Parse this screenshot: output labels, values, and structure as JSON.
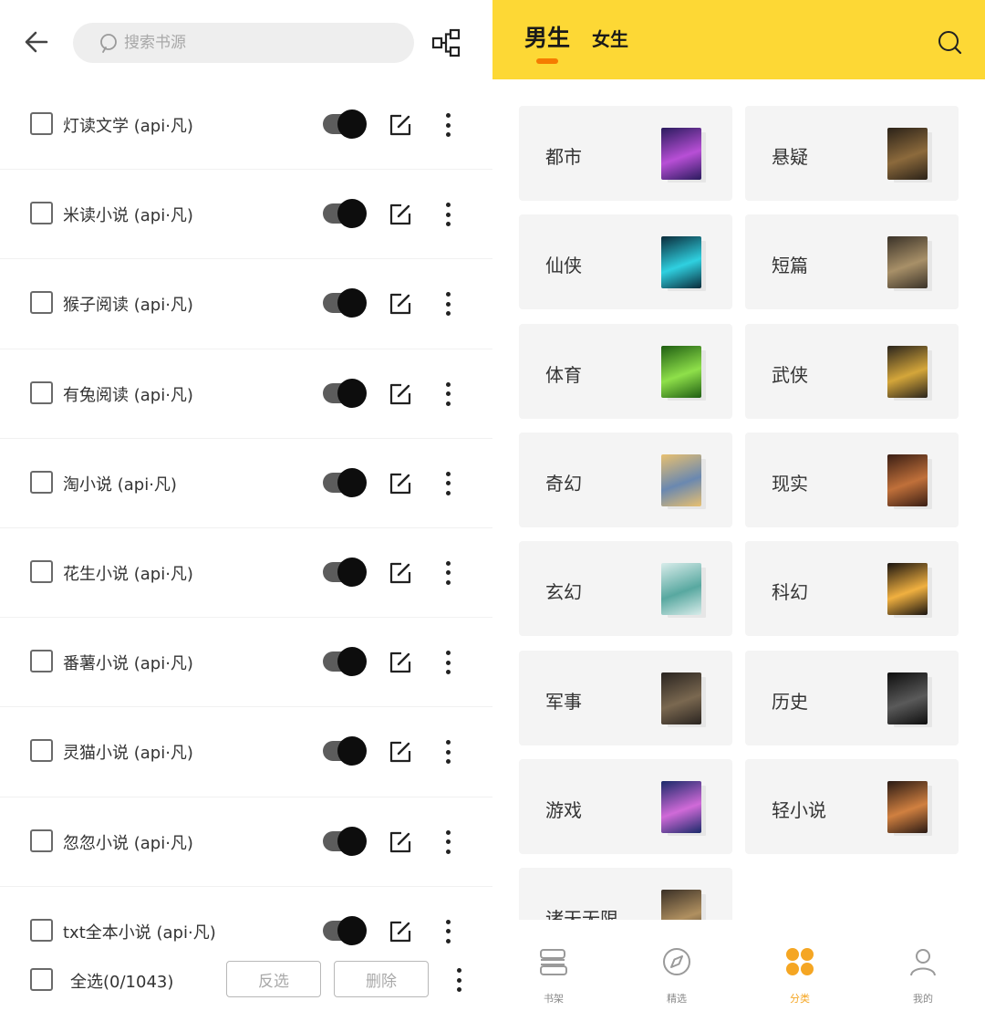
{
  "left": {
    "search": {
      "placeholder": "搜索书源"
    },
    "sources": [
      {
        "name": "灯读文学 (api·凡)",
        "enabled": true,
        "checked": false
      },
      {
        "name": "米读小说 (api·凡)",
        "enabled": true,
        "checked": false
      },
      {
        "name": "猴子阅读 (api·凡)",
        "enabled": true,
        "checked": false
      },
      {
        "name": "有兔阅读 (api·凡)",
        "enabled": true,
        "checked": false
      },
      {
        "name": "淘小说 (api·凡)",
        "enabled": true,
        "checked": false
      },
      {
        "name": "花生小说 (api·凡)",
        "enabled": true,
        "checked": false
      },
      {
        "name": "番薯小说 (api·凡)",
        "enabled": true,
        "checked": false
      },
      {
        "name": "灵猫小说 (api·凡)",
        "enabled": true,
        "checked": false
      },
      {
        "name": "忽忽小说 (api·凡)",
        "enabled": true,
        "checked": false
      },
      {
        "name": "txt全本小说 (api·凡)",
        "enabled": true,
        "checked": false
      }
    ],
    "footer": {
      "select_all_label": "全选(0/1043)",
      "invert_label": "反选",
      "delete_label": "删除"
    }
  },
  "right": {
    "tabs": {
      "male": "男生",
      "female": "女生"
    },
    "categories": [
      {
        "label": "都市",
        "cover_colors": [
          "#2a1b5e",
          "#b84fd6"
        ]
      },
      {
        "label": "悬疑",
        "cover_colors": [
          "#2b2218",
          "#8c6a3c"
        ]
      },
      {
        "label": "仙侠",
        "cover_colors": [
          "#0a2b3a",
          "#2fd0e0"
        ]
      },
      {
        "label": "短篇",
        "cover_colors": [
          "#3a3228",
          "#a89068"
        ]
      },
      {
        "label": "体育",
        "cover_colors": [
          "#1f5e12",
          "#8fe04a"
        ]
      },
      {
        "label": "武侠",
        "cover_colors": [
          "#2a241c",
          "#d4a63a"
        ]
      },
      {
        "label": "奇幻",
        "cover_colors": [
          "#e8c070",
          "#6a88b0"
        ]
      },
      {
        "label": "现实",
        "cover_colors": [
          "#3a1e14",
          "#c0703a"
        ]
      },
      {
        "label": "玄幻",
        "cover_colors": [
          "#d8ecea",
          "#58a8a0"
        ]
      },
      {
        "label": "科幻",
        "cover_colors": [
          "#1a1410",
          "#f0b040"
        ]
      },
      {
        "label": "军事",
        "cover_colors": [
          "#2a2420",
          "#7a6850"
        ]
      },
      {
        "label": "历史",
        "cover_colors": [
          "#0e0e0e",
          "#5a5a5a"
        ]
      },
      {
        "label": "游戏",
        "cover_colors": [
          "#1a2a6a",
          "#d06ad8"
        ]
      },
      {
        "label": "轻小说",
        "cover_colors": [
          "#2a1a14",
          "#d08040"
        ]
      },
      {
        "label": "诸天无限",
        "cover_colors": [
          "#3a3026",
          "#b09060"
        ]
      }
    ],
    "nav": [
      {
        "label": "书架",
        "icon": "bookshelf-icon",
        "active": false
      },
      {
        "label": "精选",
        "icon": "compass-icon",
        "active": false
      },
      {
        "label": "分类",
        "icon": "category-icon",
        "active": true
      },
      {
        "label": "我的",
        "icon": "profile-icon",
        "active": false
      }
    ],
    "accent_color": "#fdd835",
    "active_nav_color": "#f5a623"
  }
}
